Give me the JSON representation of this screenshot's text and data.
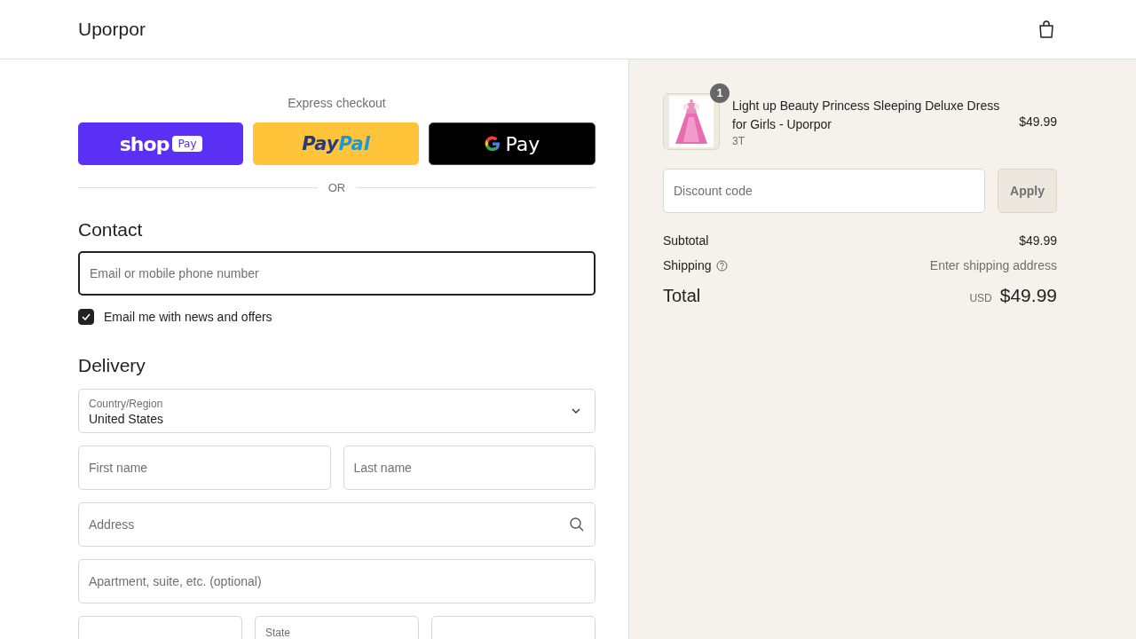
{
  "header": {
    "brand": "Uporpor"
  },
  "express": {
    "title": "Express checkout",
    "divider": "OR",
    "buttons": [
      {
        "kind": "shop",
        "label": "shop",
        "badge": "Pay"
      },
      {
        "kind": "paypal",
        "label": "Pay",
        "label_2": "Pal"
      },
      {
        "kind": "gpay",
        "label": "Pay"
      }
    ]
  },
  "contact": {
    "title": "Contact",
    "email": {
      "placeholder": "Email or mobile phone number",
      "focused": true
    },
    "newsletter": {
      "label": "Email me with news and offers",
      "checked": true
    }
  },
  "delivery": {
    "title": "Delivery",
    "country": {
      "label": "Country/Region",
      "value": "United States"
    },
    "rows": [
      [
        {
          "kind": "text",
          "placeholder": "First name"
        },
        {
          "kind": "text",
          "placeholder": "Last name"
        }
      ],
      [
        {
          "kind": "search",
          "placeholder": "Address"
        }
      ],
      [
        {
          "kind": "text",
          "placeholder": "Apartment, suite, etc. (optional)"
        }
      ],
      [
        {
          "kind": "blank"
        },
        {
          "kind": "label",
          "label": "State"
        },
        {
          "kind": "blank"
        }
      ]
    ]
  },
  "summary": {
    "item": {
      "quantity": "1",
      "name": "Light up Beauty Princess Sleeping Deluxe Dress for Girls - Uporpor",
      "variant": "3T",
      "price": "$49.99"
    },
    "discount": {
      "placeholder": "Discount code",
      "button": "Apply"
    },
    "subtotal": {
      "label": "Subtotal",
      "value": "$49.99"
    },
    "shipping": {
      "label": "Shipping",
      "value": "Enter shipping address"
    },
    "total": {
      "label": "Total",
      "currency": "USD",
      "value": "$49.99"
    }
  }
}
